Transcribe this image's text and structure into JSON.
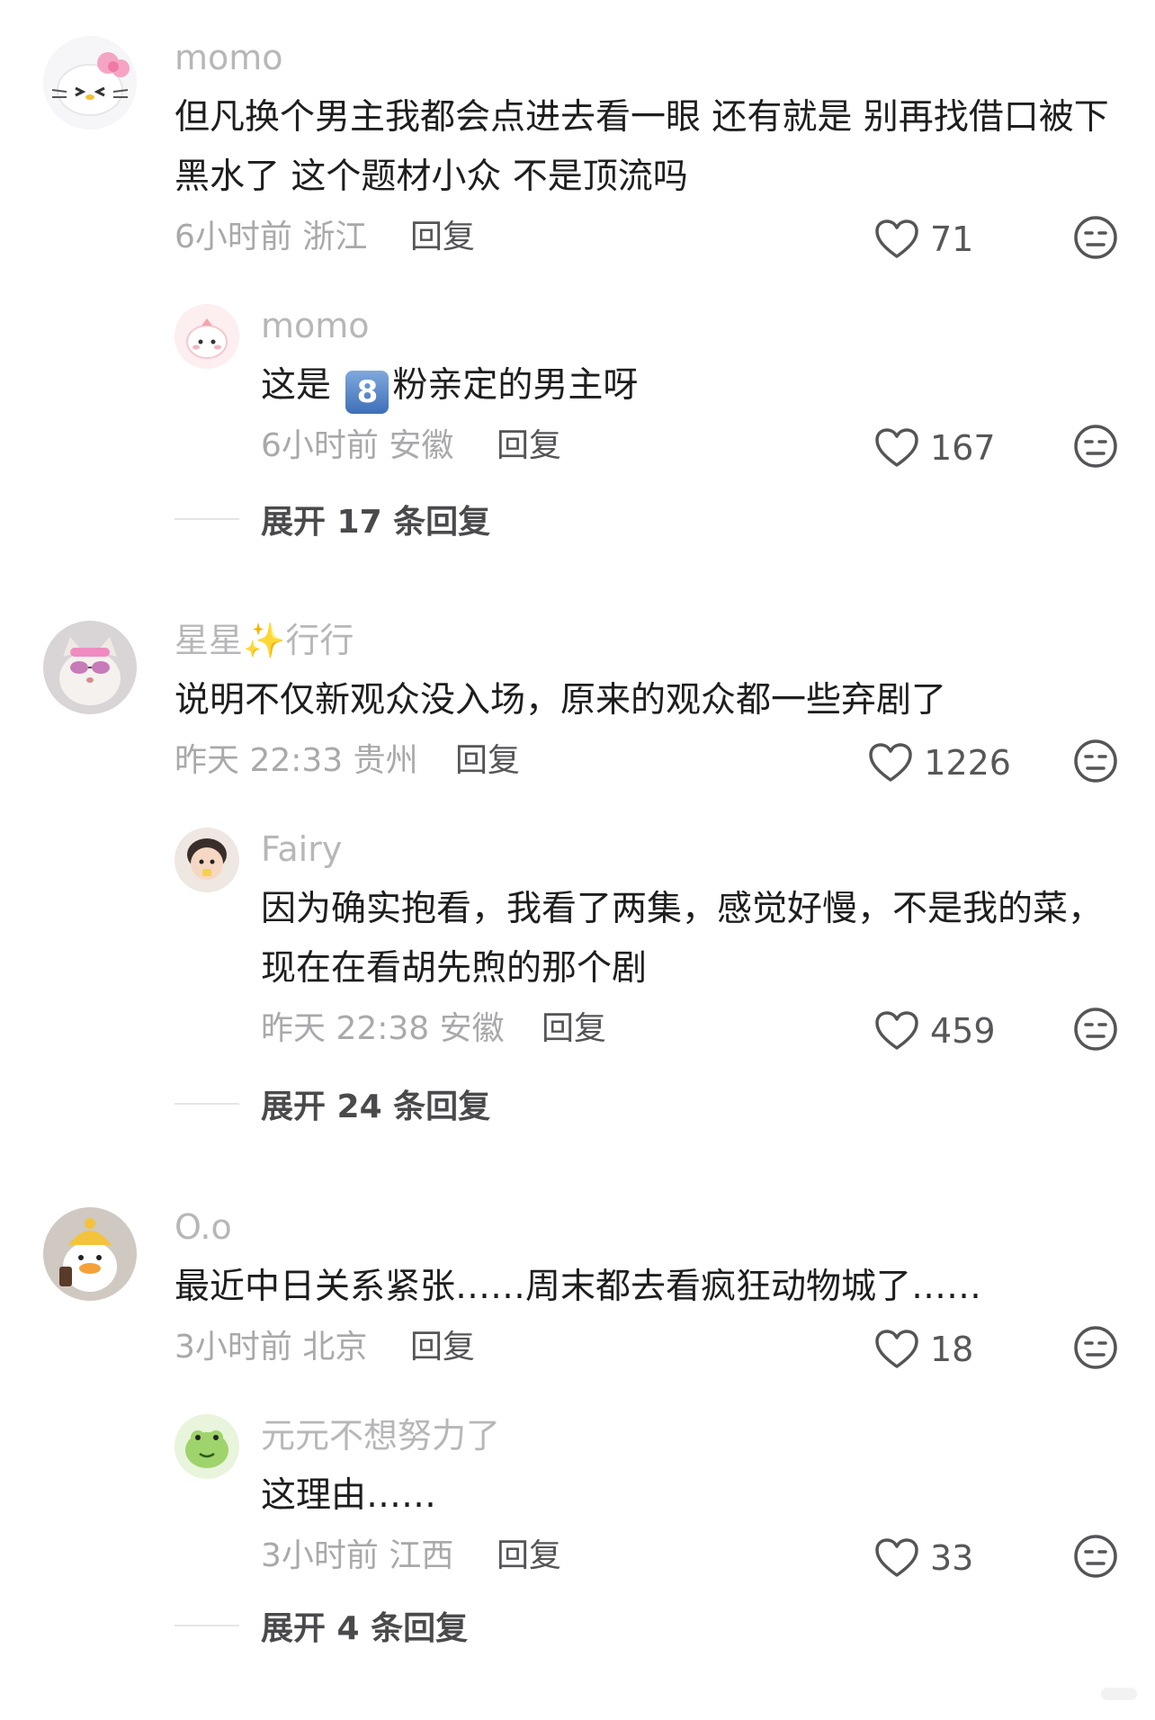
{
  "threads": [
    {
      "comment": {
        "username": "momo",
        "text": "但凡换个男主我都会点进去看一眼 还有就是 别再找借口被下黑水了 这个题材小众 不是顶流吗",
        "time_location": "6小时前 浙江",
        "reply_label": "回复",
        "likes": "71"
      },
      "reply": {
        "username": "momo",
        "text_before": "这是 ",
        "emoji_digit": "8",
        "text_after": "粉亲定的男主呀",
        "time_location": "6小时前 安徽",
        "reply_label": "回复",
        "likes": "167"
      },
      "expand_label": "展开 17 条回复"
    },
    {
      "comment": {
        "username_part1": "星星",
        "username_sparkle": "✨",
        "username_part2": "行行",
        "text": "说明不仅新观众没入场，原来的观众都一些弃剧了",
        "time_location": "昨天 22:33 贵州",
        "reply_label": "回复",
        "likes": "1226"
      },
      "reply": {
        "username": "Fairy",
        "text": "因为确实抱看，我看了两集，感觉好慢，不是我的菜，现在在看胡先煦的那个剧",
        "time_location": "昨天 22:38 安徽",
        "reply_label": "回复",
        "likes": "459"
      },
      "expand_label": "展开 24 条回复"
    },
    {
      "comment": {
        "username": "O.o",
        "text": "最近中日关系紧张……周末都去看疯狂动物城了……",
        "time_location": "3小时前 北京",
        "reply_label": "回复",
        "likes": "18"
      },
      "reply": {
        "username": "元元不想努力了",
        "text": "这理由……",
        "time_location": "3小时前 江西",
        "reply_label": "回复",
        "likes": "33"
      },
      "expand_label": "展开 4 条回复"
    }
  ],
  "icons": {
    "like": "heart-outline-icon",
    "dislike": "dislike-face-icon"
  },
  "colors": {
    "username": "#b7b7b9",
    "meta": "#a9a9ab",
    "text": "#1e1e1e",
    "icon": "#555558",
    "emoji_box": "#4a7cc4"
  }
}
